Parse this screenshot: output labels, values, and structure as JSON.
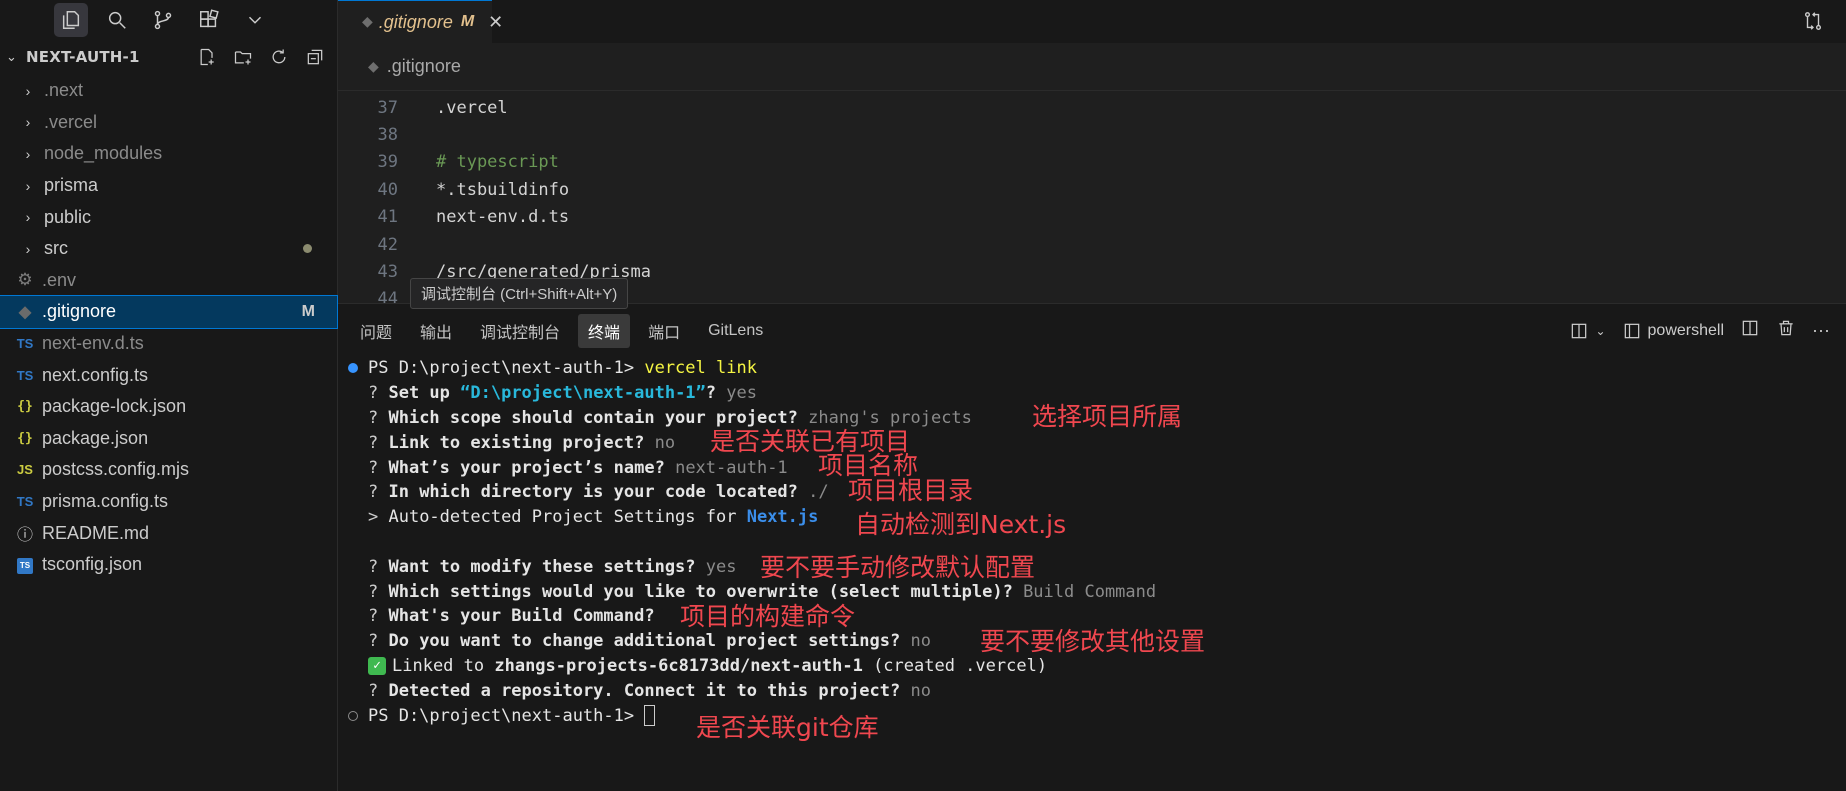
{
  "explorer": {
    "project": "NEXT-AUTH-1",
    "items": [
      {
        "type": "folder",
        "label": ".next",
        "dim": true
      },
      {
        "type": "folder",
        "label": ".vercel",
        "dim": true
      },
      {
        "type": "folder",
        "label": "node_modules",
        "dim": true
      },
      {
        "type": "folder",
        "label": "prisma",
        "dim": false
      },
      {
        "type": "folder",
        "label": "public",
        "dim": false
      },
      {
        "type": "folder",
        "label": "src",
        "dim": false,
        "modified_dot": true
      },
      {
        "type": "file",
        "icon": "gear-icon",
        "label": ".env",
        "dim": true
      },
      {
        "type": "file",
        "icon": "git-icon",
        "label": ".gitignore",
        "selected": true,
        "badge": "M"
      },
      {
        "type": "file",
        "icon": "ts-icon",
        "icon_text": "TS",
        "label": "next-env.d.ts",
        "dim": true
      },
      {
        "type": "file",
        "icon": "ts-icon",
        "icon_text": "TS",
        "label": "next.config.ts"
      },
      {
        "type": "file",
        "icon": "json-icon",
        "icon_text": "{}",
        "label": "package-lock.json"
      },
      {
        "type": "file",
        "icon": "json-icon",
        "icon_text": "{}",
        "label": "package.json"
      },
      {
        "type": "file",
        "icon": "js-icon",
        "icon_text": "JS",
        "label": "postcss.config.mjs"
      },
      {
        "type": "file",
        "icon": "ts-icon",
        "icon_text": "TS",
        "label": "prisma.config.ts"
      },
      {
        "type": "file",
        "icon": "info-icon",
        "icon_text": "ⓘ",
        "label": "README.md"
      },
      {
        "type": "file",
        "icon": "tsconfig-icon",
        "icon_text": "TS",
        "label": "tsconfig.json"
      }
    ]
  },
  "editor": {
    "tab": {
      "name": ".gitignore",
      "status": "M"
    },
    "breadcrumb": ".gitignore",
    "lines": [
      {
        "n": "37",
        "text": ".vercel",
        "kind": "normal"
      },
      {
        "n": "38",
        "text": "",
        "kind": "normal"
      },
      {
        "n": "39",
        "text": "# typescript",
        "kind": "comment"
      },
      {
        "n": "40",
        "text": "*.tsbuildinfo",
        "kind": "normal"
      },
      {
        "n": "41",
        "text": "next-env.d.ts",
        "kind": "normal"
      },
      {
        "n": "42",
        "text": "",
        "kind": "normal"
      },
      {
        "n": "43",
        "text": "/src/generated/prisma",
        "kind": "normal"
      },
      {
        "n": "44",
        "text": "",
        "kind": "normal"
      }
    ]
  },
  "tooltip": "调试控制台 (Ctrl+Shift+Alt+Y)",
  "panel": {
    "tabs": [
      "问题",
      "输出",
      "调试控制台",
      "终端",
      "端口",
      "GitLens"
    ],
    "active_tab": "终端",
    "shell": "powershell"
  },
  "terminal": {
    "prompt": "PS D:\\project\\next-auth-1> ",
    "command": "vercel link",
    "q_setup": "Set up ",
    "q_setup_path": "“D:\\project\\next-auth-1”",
    "q_setup_ans": "yes",
    "q_scope": "Which scope should contain your project?",
    "q_scope_ans": "zhang's projects",
    "q_link": "Link to existing project?",
    "q_link_ans": "no",
    "q_name": "What’s your project’s name?",
    "q_name_ans": "next-auth-1",
    "q_dir": "In which directory is your code located?",
    "q_dir_ans": "./",
    "autodetect": "Auto-detected Project Settings for ",
    "framework": "Next.js",
    "q_modify": "Want to modify these settings?",
    "q_modify_ans": "yes",
    "q_overwrite": "Which settings would you like to overwrite (select multiple)?",
    "q_overwrite_ans": "Build Command",
    "q_build": "What's your Build Command?",
    "q_additional": "Do you want to change additional project settings?",
    "q_additional_ans": "no",
    "linked": "Linked to ",
    "linked_target": "zhangs-projects-6c8173dd/next-auth-1",
    "linked_note": " (created .vercel)",
    "q_repo": "Detected a repository. Connect it to this project?",
    "q_repo_ans": "no"
  },
  "annotations": {
    "scope": "选择项目所属",
    "link": "是否关联已有项目",
    "name": "项目名称",
    "dir": "项目根目录",
    "detect": "自动检测到Next.js",
    "modify": "要不要手动修改默认配置",
    "build": "项目的构建命令",
    "additional": "要不要修改其他设置",
    "git": "是否关联git仓库"
  }
}
